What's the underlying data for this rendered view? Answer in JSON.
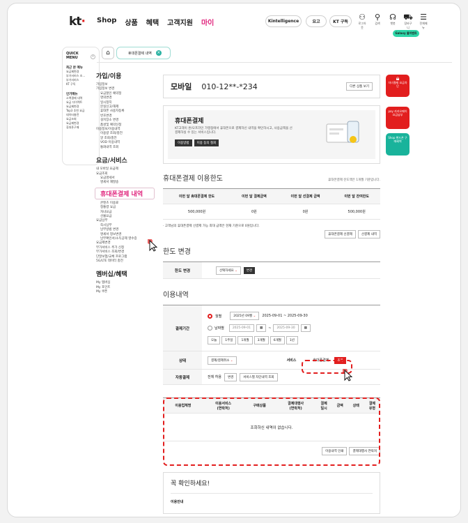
{
  "header": {
    "logo": "kt",
    "nav": [
      "Shop",
      "상품",
      "혜택",
      "고객지원",
      "마이"
    ],
    "active_nav": "마이",
    "pills": [
      "Kintelligence",
      "요고",
      "KT 구독"
    ],
    "icons": [
      {
        "name": "user-icon",
        "label": "로그아웃"
      },
      {
        "name": "search-icon",
        "label": "검색"
      },
      {
        "name": "headset-icon",
        "label": "챗봇"
      },
      {
        "name": "cart-icon",
        "label": "장바구니"
      },
      {
        "name": "menu-icon",
        "label": "전체메뉴"
      }
    ],
    "galaxy_badge": "Galaxy 몰이벤트"
  },
  "quick": {
    "title1": "QUICK",
    "title2": "MENU",
    "recent_title": "최근 본 메뉴",
    "recent": [
      "요금제변경",
      "부가서비스 조...",
      "부가서비스",
      "KT 구독"
    ],
    "popular_title": "인기메뉴",
    "popular": [
      "소액결제 내역",
      "요금 다이렉트",
      "요금제변경",
      "Top3 추천 요금",
      "데이터충전",
      "요금조회",
      "요금제변경",
      "휴대폰구매"
    ]
  },
  "tab": {
    "label": "휴대폰결제 내역"
  },
  "lnav": {
    "g1_title": "가입/이용",
    "g1": [
      {
        "t": "가입정보",
        "l": 0
      },
      {
        "t": "가입정보 변경",
        "l": 0
      },
      {
        "t": "요금할인 예약정",
        "l": 1
      },
      {
        "t": "명의변경",
        "l": 1
      },
      {
        "t": "일시정지",
        "l": 1
      },
      {
        "t": "분실신고/해제",
        "l": 1
      },
      {
        "t": "휴대폰 사용자등록",
        "l": 1
      },
      {
        "t": "번호변경",
        "l": 1
      },
      {
        "t": "설치장소 변경",
        "l": 1
      },
      {
        "t": "품성및 예약신청",
        "l": 1
      },
      {
        "t": "이용정보/이용내역",
        "l": 0
      },
      {
        "t": "이용량 조회/충전",
        "l": 1
      },
      {
        "t": "알 조회/충전",
        "l": 1
      },
      {
        "t": "VOD 이용내역",
        "l": 1
      },
      {
        "t": "통화내역 조회",
        "l": 1
      }
    ],
    "g2_title": "요금/서비스",
    "g2a": [
      {
        "t": "내 모바일 요금제",
        "l": 0
      },
      {
        "t": "요금조회",
        "l": 0
      },
      {
        "t": "요금명세서",
        "l": 1
      },
      {
        "t": "명세서 재발송",
        "l": 1
      }
    ],
    "highlight": "휴대폰결제 내역",
    "g2b": [
      {
        "t": "콘텐츠 이용료",
        "l": 1
      },
      {
        "t": "정통령 요금",
        "l": 1
      },
      {
        "t": "자녀요금",
        "l": 1
      },
      {
        "t": "선불요금",
        "l": 1
      },
      {
        "t": "요금납부",
        "l": 0
      },
      {
        "t": "즉시납부",
        "l": 1
      },
      {
        "t": "납부방법 변경",
        "l": 1
      },
      {
        "t": "명세서 정보변경",
        "l": 1
      },
      {
        "t": "납부확인서/소득공제 영수증",
        "l": 1
      },
      {
        "t": "요금제변경",
        "l": 0
      },
      {
        "t": "부가서비스 추가 신청",
        "l": 0
      },
      {
        "t": "부가서비스 조회/변경",
        "l": 0
      },
      {
        "t": "단말보험/교체 프로그램",
        "l": 0
      },
      {
        "t": "5G/LTE 데이터 충전",
        "l": 0
      }
    ],
    "g3_title": "멤버십/혜택",
    "g3": [
      {
        "t": "My 멤버십",
        "l": 0
      },
      {
        "t": "My 포인트",
        "l": 0
      },
      {
        "t": "My 쿠폰",
        "l": 0
      }
    ]
  },
  "phone": {
    "label": "모바일",
    "number": "010-12**-*234",
    "other_btn": "다른 상품 보기"
  },
  "info": {
    "title": "휴대폰결제",
    "desc": "KT고객이 온/오프라인 가맹점에서 휴대폰으로 결제하신 내역을 확인하시고, 사용금액을 선결제하실 수 있는 서비스입니다.",
    "btn1": "이용방법",
    "btn2": "이용 동의 철회"
  },
  "limit": {
    "title": "휴대폰결제 이용한도",
    "note": "휴대폰결제 잔도액은 1개월 기준입니다.",
    "headers": [
      "이번 달 휴대폰결제 한도",
      "이번 달 결제금액",
      "이번 달 선결제 금액",
      "이번 달 잔여한도"
    ],
    "values": [
      "500,000원",
      "0원",
      "0원",
      "500,000원"
    ],
    "footnote": "· 고객님의 휴대폰결제 선결제 가능 최대 금액은 현재 기준으로 0원입니다.",
    "btn1": "휴대폰결제 선결제",
    "btn2": "선결제 내역"
  },
  "change": {
    "title": "한도 변경",
    "label": "한도 변경",
    "select": "선택하세요",
    "btn": "변경"
  },
  "usage": {
    "title": "이용내역",
    "period_label": "결제기간",
    "monthly": "월별",
    "month_select": "2025년 09월",
    "month_range": "2025-09-01 ~ 2025-09-30",
    "daily": "날짜별",
    "date_from": "2025-09-01",
    "date_to": "2025-09-30",
    "quick_ranges": [
      "오늘",
      "1주일",
      "1개월",
      "3개월",
      "6개월",
      "1년"
    ],
    "status_label": "상태",
    "status_select": "결제/결제취소",
    "service_label": "서비스",
    "service_value": "휴대폰결제",
    "search_btn": "조회",
    "auto_label": "자동결제",
    "auto_value": "전체 허용",
    "auto_btn1": "변경",
    "auto_btn2": "서비스별 차단내역 조회"
  },
  "results": {
    "headers": [
      "이용업체명",
      "이용서비스\n(연락처)",
      "구매상품",
      "결제대행사\n(연락처)",
      "결제\n일시",
      "금액",
      "상태",
      "결제\n유형"
    ],
    "empty": "조회하신 내역이 없습니다.",
    "btn1": "이용내역 인쇄",
    "btn2": "결제대행사 연락처"
  },
  "notice": {
    "title": "꼭 확인하세요!",
    "sub": "이용안내"
  },
  "banners": [
    {
      "text": "자녀결제 요금차단",
      "color": "#e21e1e"
    },
    {
      "text": "pay 카카오페이 요금납부",
      "color": "#e21e1e"
    },
    {
      "text": "Shop 핸드폰 구매혜택",
      "color": "#19b39b"
    }
  ],
  "colors": {
    "accent": "#e0257d",
    "red": "#e21e1e",
    "teal": "#2bb3a3"
  }
}
